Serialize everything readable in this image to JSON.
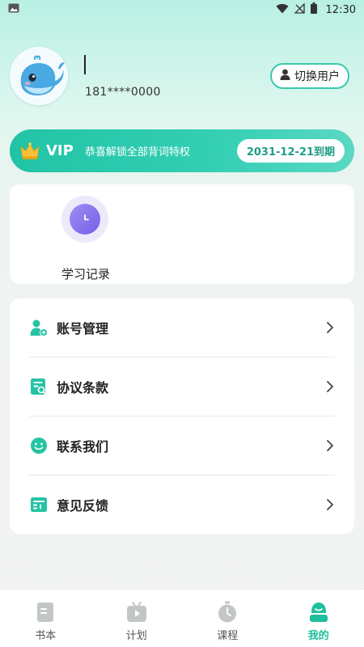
{
  "status_bar": {
    "time": "12:30"
  },
  "profile": {
    "phone": "181****0000",
    "switch_button": "切换用户"
  },
  "vip": {
    "badge": "VIP",
    "description": "恭喜解锁全部背词特权",
    "expire": "2031-12-21到期"
  },
  "quick_actions": [
    {
      "label": "学习记录",
      "icon": "clock-icon"
    }
  ],
  "menu": [
    {
      "label": "账号管理",
      "icon": "account-icon"
    },
    {
      "label": "协议条款",
      "icon": "agreement-icon"
    },
    {
      "label": "联系我们",
      "icon": "smile-icon"
    },
    {
      "label": "意见反馈",
      "icon": "feedback-icon"
    }
  ],
  "tabs": [
    {
      "label": "书本",
      "icon": "book-icon",
      "active": false
    },
    {
      "label": "计划",
      "icon": "plan-icon",
      "active": false
    },
    {
      "label": "课程",
      "icon": "course-icon",
      "active": false
    },
    {
      "label": "我的",
      "icon": "profile-icon",
      "active": true
    }
  ],
  "colors": {
    "accent": "#1fbf9d",
    "vip_gradient_start": "#21c3a6",
    "quick_icon": "#7560e8"
  }
}
